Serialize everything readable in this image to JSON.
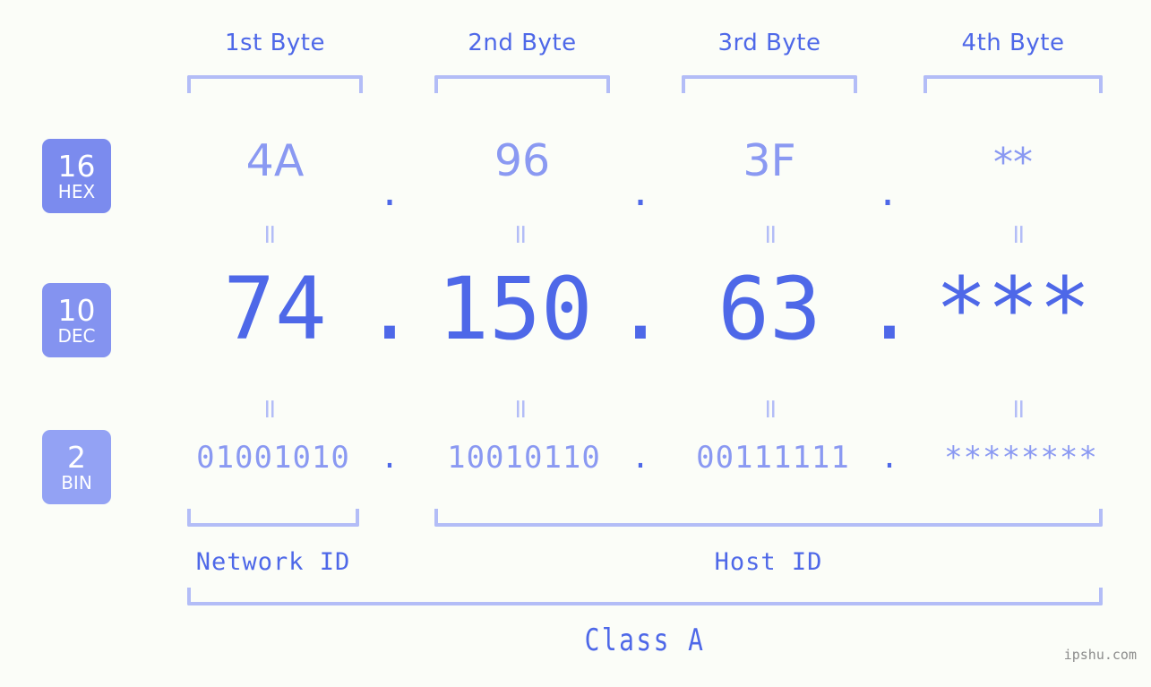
{
  "meta": {
    "background_color": "#fbfdf8",
    "accent_color": "#4e68e8",
    "accent_light_color": "#8a99f2",
    "bracket_color": "#b3bdf7",
    "badge_color": "#7b8bee",
    "watermark": "ipshu.com"
  },
  "byte_headers": [
    {
      "label": "1st Byte"
    },
    {
      "label": "2nd Byte"
    },
    {
      "label": "3rd Byte"
    },
    {
      "label": "4th Byte"
    }
  ],
  "rows": [
    {
      "badge_number": "16",
      "badge_name": "HEX",
      "values": [
        "4A",
        "96",
        "3F",
        "**"
      ],
      "separators": [
        ".",
        ".",
        "."
      ]
    },
    {
      "badge_number": "10",
      "badge_name": "DEC",
      "values": [
        "74",
        "150",
        "63",
        "***"
      ],
      "separators": [
        ".",
        ".",
        "."
      ]
    },
    {
      "badge_number": "2",
      "badge_name": "BIN",
      "values": [
        "01001010",
        "10010110",
        "00111111",
        "********"
      ],
      "separators": [
        ".",
        ".",
        "."
      ]
    }
  ],
  "equals_glyph": "=",
  "footer": {
    "network_id_label": "Network ID",
    "host_id_label": "Host ID",
    "class_label": "Class A"
  }
}
